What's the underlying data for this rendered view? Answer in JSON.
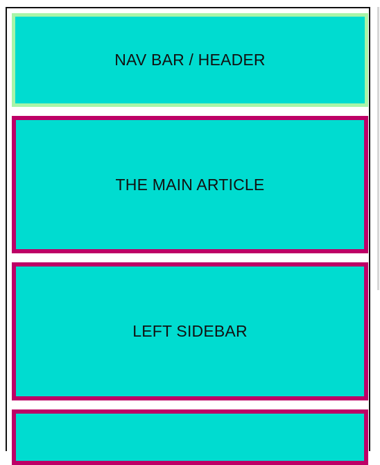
{
  "layout": {
    "header": {
      "label": "NAV BAR / HEADER"
    },
    "main_article": {
      "label": "THE MAIN ARTICLE"
    },
    "left_sidebar": {
      "label": "LEFT SIDEBAR"
    },
    "next_section": {
      "label": ""
    }
  },
  "colors": {
    "box_fill": "#00dcd0",
    "header_border": "#a8f5a8",
    "section_border": "#bd0066",
    "outer_border": "#111111"
  }
}
